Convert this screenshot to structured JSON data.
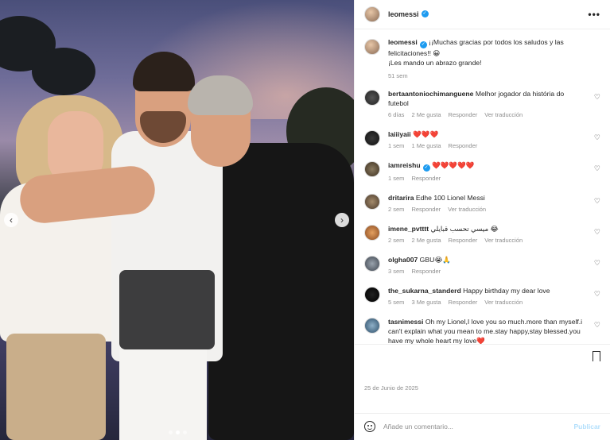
{
  "header": {
    "username": "leomessi",
    "verified_icon": "verified-badge-icon",
    "more": "•••"
  },
  "caption": {
    "username": "leomessi",
    "text": " ¡¡Muchas gracias por todos los saludos y las felicitaciones!! 😀",
    "line2": "¡Les mando un abrazo grande!",
    "time": "51 sem"
  },
  "comments": [
    {
      "username": "bertaantoniochimanguene",
      "text": "Melhor jogador da história do futebol",
      "time": "6 días",
      "likes": "2 Me gusta",
      "reply": "Responder",
      "translate": "Ver traducción"
    },
    {
      "username": "laiiiyaii",
      "text": "❤️❤️❤️",
      "time": "1 sem",
      "likes": "1 Me gusta",
      "reply": "Responder",
      "translate": ""
    },
    {
      "username": "iamreishu",
      "text": "❤️❤️❤️❤️❤️",
      "time": "1 sem",
      "likes": "",
      "reply": "Responder",
      "translate": ""
    },
    {
      "username": "dritarira",
      "text": "Edhe 100 Lionel Messi",
      "time": "2 sem",
      "likes": "",
      "reply": "Responder",
      "translate": "Ver traducción"
    },
    {
      "username": "imene_pvtttt",
      "text": "ميسي تحسب قبايلي 😂",
      "time": "2 sem",
      "likes": "2 Me gusta",
      "reply": "Responder",
      "translate": "Ver traducción"
    },
    {
      "username": "olgha007",
      "text": "GBU😭🙏",
      "time": "3 sem",
      "likes": "",
      "reply": "Responder",
      "translate": ""
    },
    {
      "username": "the_sukarna_standerd",
      "text": "Happy birthday my dear love",
      "time": "5 sem",
      "likes": "3 Me gusta",
      "reply": "Responder",
      "translate": "Ver traducción"
    },
    {
      "username": "tasnimessi",
      "text": "Oh my Lionel,I love you so much.more than myself.i can't explain what you mean to me.stay happy,stay blessed.you have my whole heart my love❤️",
      "time": "",
      "likes": "",
      "reply": "",
      "translate": ""
    }
  ],
  "footer": {
    "date": "25 de Junio de 2025",
    "placeholder": "Añade un comentario...",
    "publish": "Publicar"
  },
  "icons": {
    "heart": "♡",
    "prev": "‹",
    "next": "›"
  },
  "colors": {
    "accent": "#0095f6",
    "muted": "#8e8e8e",
    "verified": "#1d9bf0"
  }
}
